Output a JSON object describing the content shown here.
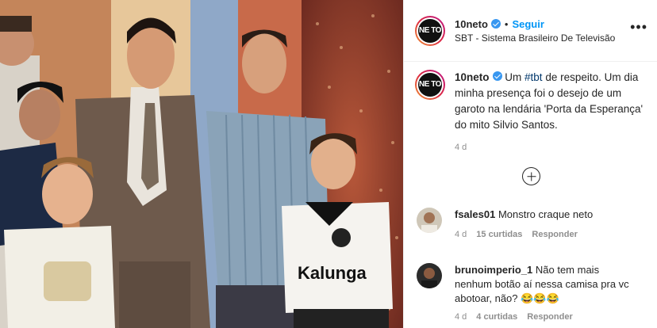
{
  "header": {
    "avatar_text": "NE TO",
    "username": "10neto",
    "separator": "•",
    "follow_label": "Seguir",
    "location": "SBT - Sistema Brasileiro De Televisão",
    "more_label": "•••"
  },
  "caption": {
    "username": "10neto",
    "prefix": "Um ",
    "hashtag": "#tbt",
    "text": " de respeito. Um dia minha presença foi o desejo de um garoto na lendária 'Porta da Esperança' do mito Silvio Santos.",
    "time": "4 d"
  },
  "photo": {
    "shirt_text": "Kalunga"
  },
  "comments": [
    {
      "username": "fsales01",
      "text": "Monstro craque neto",
      "time": "4 d",
      "likes": "15 curtidas",
      "reply_label": "Responder"
    },
    {
      "username": "brunoimperio_1",
      "text": "Não tem mais nenhum botão aí nessa camisa pra vc abotoar, não? 😂😂😂",
      "time": "4 d",
      "likes": "4 curtidas",
      "reply_label": "Responder"
    }
  ],
  "colors": {
    "link": "#0095f6",
    "hashtag": "#00376b",
    "verified": "#3897f0",
    "muted": "#8e8e8e"
  }
}
